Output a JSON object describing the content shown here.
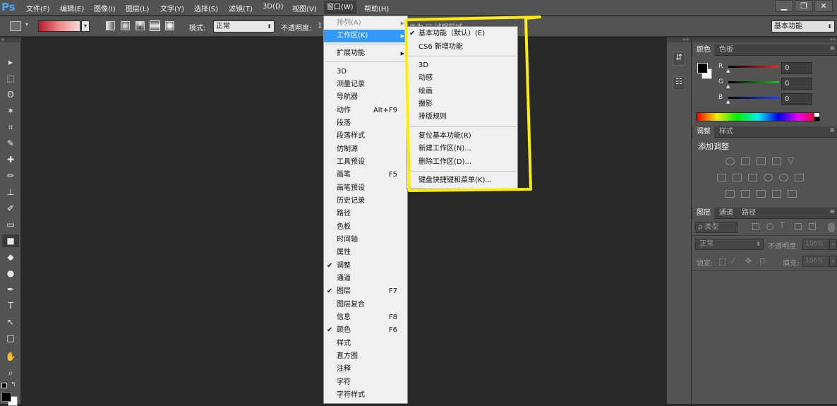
{
  "menubar": {
    "logo": "Ps",
    "items": [
      "文件(F)",
      "编辑(E)",
      "图像(I)",
      "图层(L)",
      "文字(Y)",
      "选择(S)",
      "滤镜(T)",
      "3D(D)",
      "视图(V)",
      "窗口(W)",
      "帮助(H)"
    ],
    "active": "窗口(W)",
    "window_controls": [
      "▁",
      "❐",
      "✕"
    ]
  },
  "options_bar": {
    "mode_label": "模式:",
    "mode_value": "正常",
    "opacity_label": "不透明度:",
    "opacity_value": "1",
    "workspace_value": "基本功能",
    "behind_text": "作为 ☑ 试明区域"
  },
  "window_menu": {
    "items": [
      {
        "label": "排列(A)",
        "disabled": true,
        "submenu": true
      },
      {
        "label": "工作区(K)",
        "highlighted": true,
        "submenu": true
      },
      {
        "label": "扩展功能",
        "submenu": true
      },
      {
        "label": "3D"
      },
      {
        "label": "测量记录"
      },
      {
        "label": "导航器"
      },
      {
        "label": "动作",
        "shortcut": "Alt+F9"
      },
      {
        "label": "段落"
      },
      {
        "label": "段落样式"
      },
      {
        "label": "仿制源"
      },
      {
        "label": "工具预设"
      },
      {
        "label": "画笔",
        "shortcut": "F5"
      },
      {
        "label": "画笔预设"
      },
      {
        "label": "历史记录"
      },
      {
        "label": "路径"
      },
      {
        "label": "色板"
      },
      {
        "label": "时间轴"
      },
      {
        "label": "属性"
      },
      {
        "label": "调整",
        "checked": true
      },
      {
        "label": "通道"
      },
      {
        "label": "图层",
        "checked": true,
        "shortcut": "F7"
      },
      {
        "label": "图层复合"
      },
      {
        "label": "信息",
        "shortcut": "F8"
      },
      {
        "label": "颜色",
        "checked": true,
        "shortcut": "F6"
      },
      {
        "label": "样式"
      },
      {
        "label": "直方图"
      },
      {
        "label": "注释"
      },
      {
        "label": "字符"
      },
      {
        "label": "字符样式"
      }
    ]
  },
  "workspace_submenu": {
    "items": [
      {
        "label": "基本功能（默认）(E)",
        "checked": true
      },
      {
        "label": "CS6 新增功能"
      },
      {
        "label": "3D"
      },
      {
        "label": "动感"
      },
      {
        "label": "绘画"
      },
      {
        "label": "摄影"
      },
      {
        "label": "排版规则"
      },
      {
        "label": "复位基本功能(R)"
      },
      {
        "label": "新建工作区(N)..."
      },
      {
        "label": "删除工作区(D)..."
      },
      {
        "label": "键盘快捷键和菜单(K)..."
      }
    ],
    "highlight_color": "#ffee00"
  },
  "color_panel": {
    "tabs": [
      "颜色",
      "色板"
    ],
    "channels": [
      {
        "name": "R",
        "value": "0",
        "color": "#ff2020"
      },
      {
        "name": "G",
        "value": "0",
        "color": "#20c020"
      },
      {
        "name": "B",
        "value": "0",
        "color": "#2040ff"
      }
    ]
  },
  "adjustments_panel": {
    "tabs": [
      "调整",
      "样式"
    ],
    "title": "添加调整"
  },
  "layers_panel": {
    "tabs": [
      "图层",
      "通道",
      "路径"
    ],
    "kind_label": "ρ 类型",
    "blend_mode": "正常",
    "opacity_label": "不透明度:",
    "opacity_value": "100%",
    "lock_label": "锁定:",
    "fill_label": "填充:",
    "fill_value": "100%"
  },
  "tools": [
    "move-tool",
    "marquee-tool",
    "lasso-tool",
    "magic-wand-tool",
    "crop-tool",
    "eyedropper-tool",
    "healing-brush-tool",
    "brush-tool",
    "clone-stamp-tool",
    "history-brush-tool",
    "eraser-tool",
    "gradient-tool",
    "blur-tool",
    "dodge-tool",
    "pen-tool",
    "type-tool",
    "path-selection-tool",
    "rectangle-tool",
    "hand-tool",
    "zoom-tool"
  ],
  "tool_glyphs": [
    "▸",
    "⬚",
    "ʘ",
    "✶",
    "⌗",
    "✎",
    "✚",
    "✏",
    "⊥",
    "✐",
    "▭",
    "■",
    "◆",
    "●",
    "✒",
    "T",
    "↖",
    "□",
    "✋",
    "⌕"
  ]
}
